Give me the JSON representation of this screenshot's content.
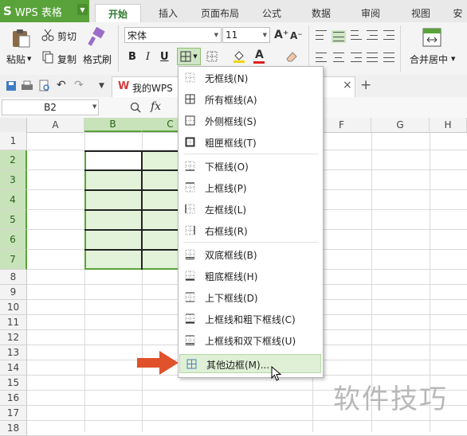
{
  "app": {
    "title": "WPS 表格"
  },
  "tabs": [
    "开始",
    "插入",
    "页面布局",
    "公式",
    "数据",
    "审阅",
    "视图",
    "安"
  ],
  "active_tab": "开始",
  "ribbon": {
    "paste_label": "粘贴",
    "cut_label": "剪切",
    "copy_label": "复制",
    "format_painter_label": "格式刷",
    "font_name": "宋体",
    "font_size": "11",
    "bold": "B",
    "italic": "I",
    "underline": "U",
    "font_color_letter": "A",
    "merge_label": "合并居中",
    "grow_font": "A⁺",
    "shrink_font": "A⁻"
  },
  "quick_access": {
    "doc_tab_label": "我的WPS",
    "close": "×",
    "new_tab": "+"
  },
  "formula_bar": {
    "name_box": "B2",
    "fx": "fx"
  },
  "grid": {
    "columns": [
      "A",
      "B",
      "C",
      "F",
      "G",
      "H"
    ],
    "rows": [
      "1",
      "2",
      "3",
      "4",
      "5",
      "6",
      "7",
      "8",
      "9",
      "10",
      "11",
      "12",
      "13",
      "14",
      "15",
      "16",
      "17",
      "18"
    ],
    "selected_range": "B2:C7"
  },
  "border_menu": {
    "items": [
      "无框线(N)",
      "所有框线(A)",
      "外侧框线(S)",
      "粗匣框线(T)",
      "下框线(O)",
      "上框线(P)",
      "左框线(L)",
      "右框线(R)",
      "双底框线(B)",
      "粗底框线(H)",
      "上下框线(D)",
      "上框线和粗下框线(C)",
      "上框线和双下框线(U)",
      "其他边框(M)..."
    ],
    "highlighted": "其他边框(M)..."
  },
  "watermark": "软件技巧",
  "colors": {
    "accent_green": "#5aa33b",
    "arrow": "#e0522c",
    "selection_fill": "#e3f3d9"
  }
}
